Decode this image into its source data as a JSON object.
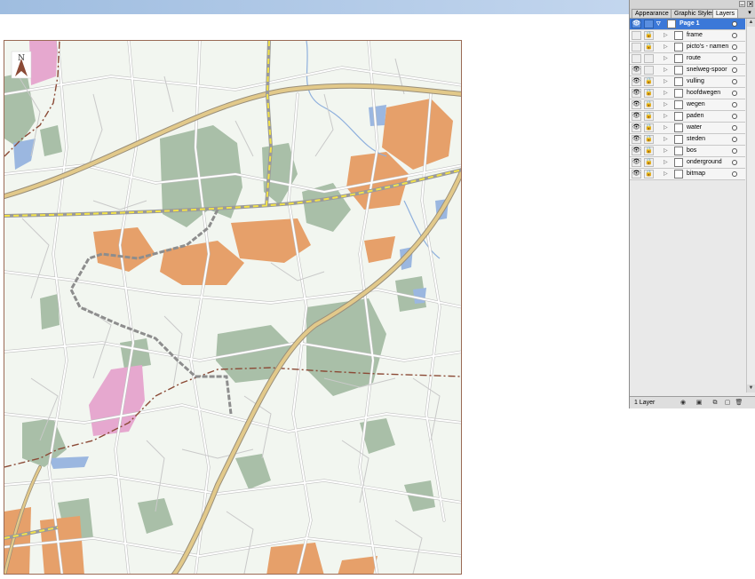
{
  "window": {
    "minimize_glyph": "–",
    "close_glyph": "✕"
  },
  "panel": {
    "tabs": [
      {
        "label": "Appearance",
        "active": false
      },
      {
        "label": "Graphic Styles",
        "active": false
      },
      {
        "label": "Layers",
        "active": true
      }
    ],
    "menu_glyph": "▾",
    "page_row": {
      "name": "Page 1",
      "eye": "👁",
      "expander": "▽"
    },
    "layers": [
      {
        "name": "frame",
        "visible": false,
        "locked": true
      },
      {
        "name": "picto's - namen",
        "visible": false,
        "locked": true
      },
      {
        "name": "route",
        "visible": false,
        "locked": false
      },
      {
        "name": "snelweg-spoor",
        "visible": true,
        "locked": false
      },
      {
        "name": "vulling",
        "visible": true,
        "locked": true
      },
      {
        "name": "hoofdwegen",
        "visible": true,
        "locked": true
      },
      {
        "name": "wegen",
        "visible": true,
        "locked": true
      },
      {
        "name": "paden",
        "visible": true,
        "locked": true
      },
      {
        "name": "water",
        "visible": true,
        "locked": true
      },
      {
        "name": "steden",
        "visible": true,
        "locked": true
      },
      {
        "name": "bos",
        "visible": true,
        "locked": true
      },
      {
        "name": "onderground",
        "visible": true,
        "locked": true
      },
      {
        "name": "bitmap",
        "visible": true,
        "locked": true
      }
    ],
    "footer": {
      "layer_count": "1 Layer"
    },
    "glyphs": {
      "eye": "👁",
      "lock": "🔒",
      "expander": "▷"
    }
  },
  "map": {
    "compass_label": "N",
    "colors": {
      "background": "#f2f6f0",
      "forest": "#a9bfa8",
      "city": "#e6a06a",
      "water": "#9bb7e0",
      "pink": "#e6a8cf",
      "road": "#ffffff",
      "road_casing": "#b5b5b5",
      "main_road": "#e2c98a",
      "main_road_casing": "#9a8f7a",
      "rail_dash": "#f3e34a",
      "route": "#8d8d8d",
      "border_line": "#8b4a36"
    }
  }
}
